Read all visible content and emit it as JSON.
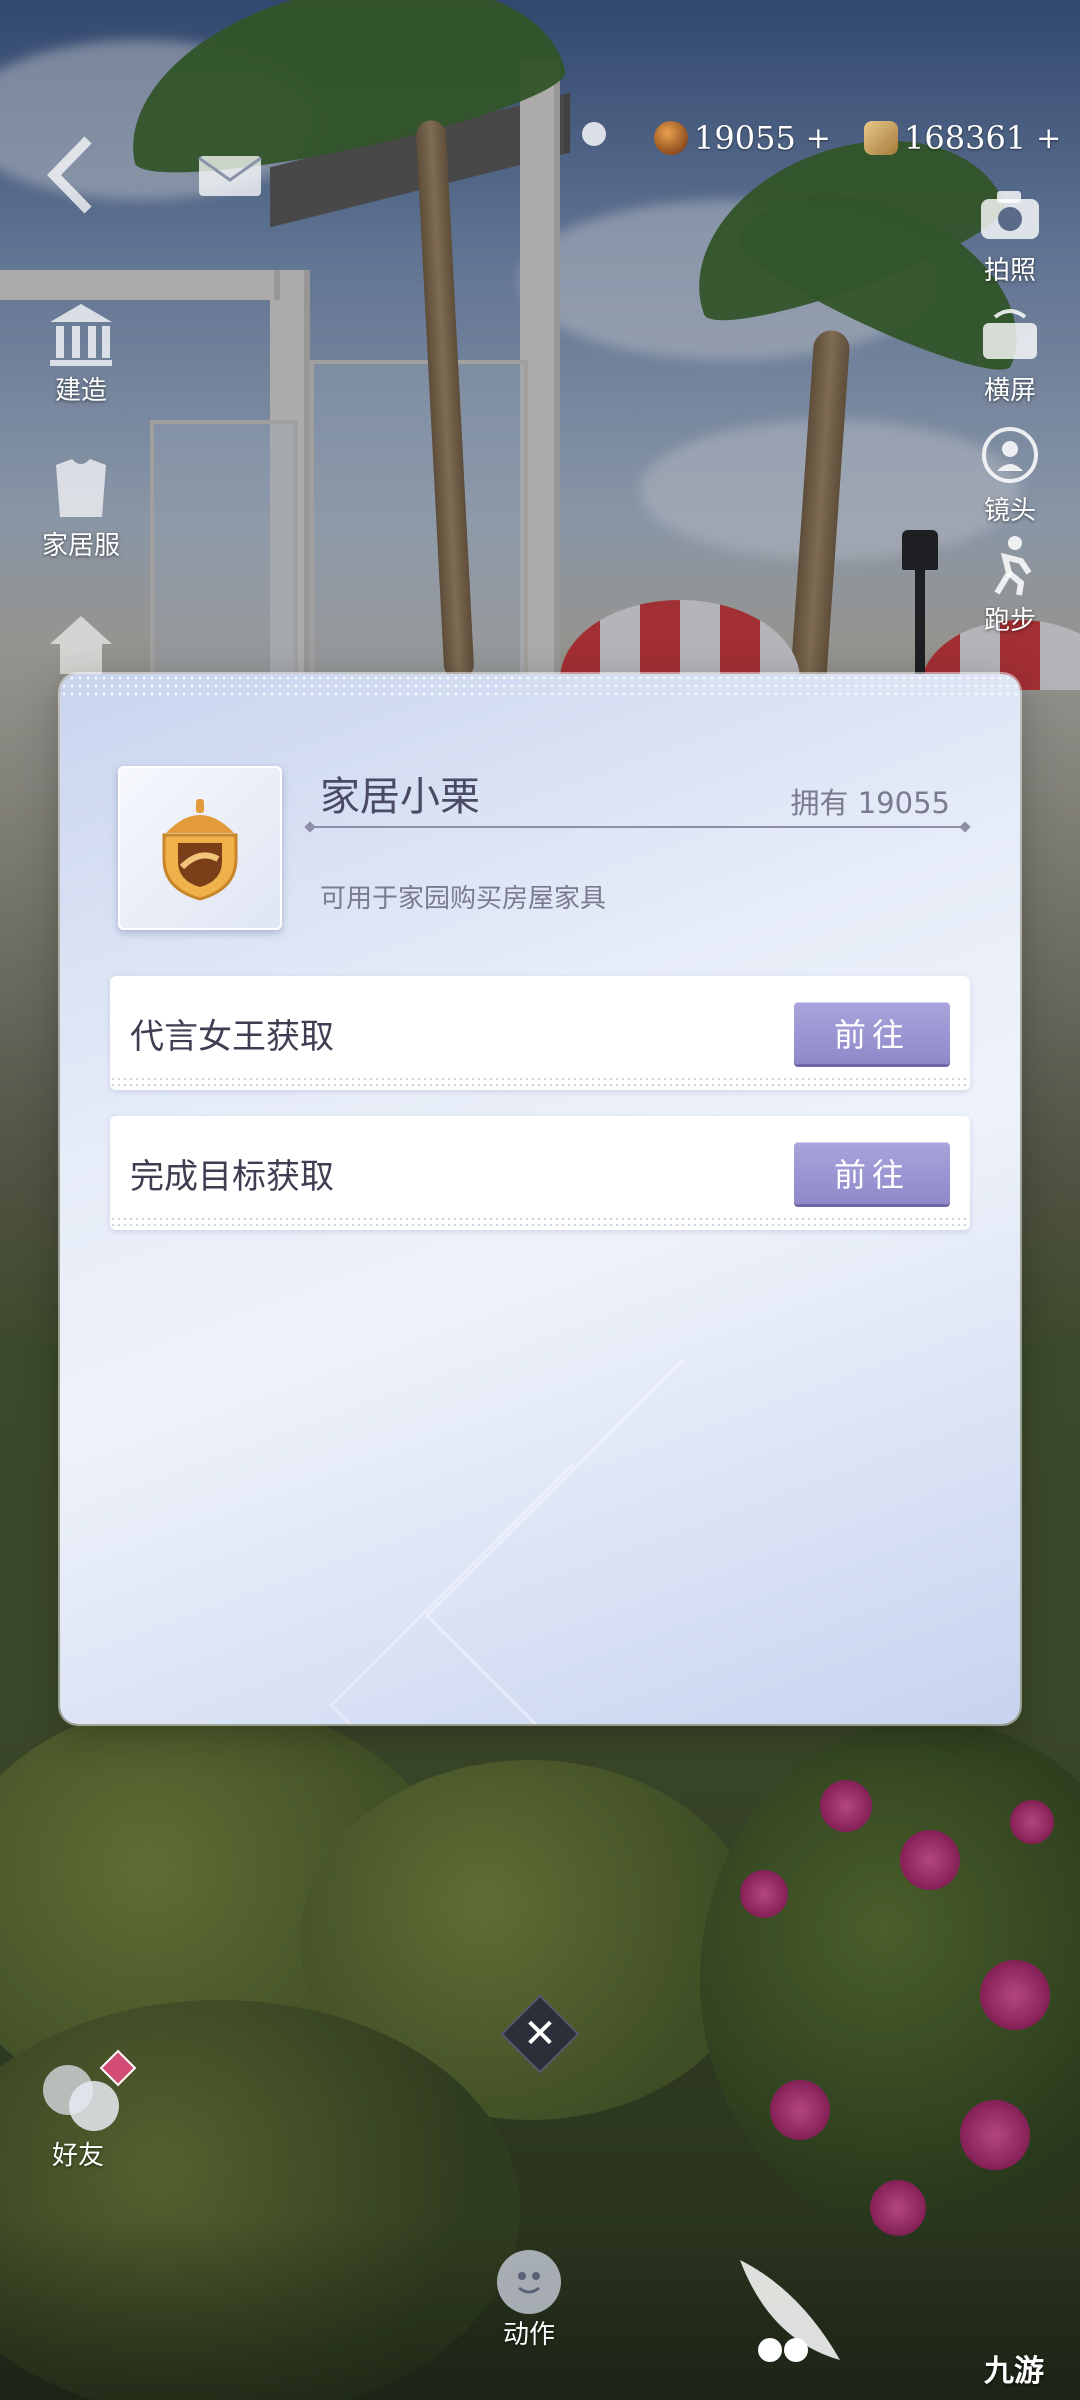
{
  "hud": {
    "currency": [
      {
        "icon": "acorn-coin-icon",
        "value": "19055",
        "plus": "+"
      },
      {
        "icon": "diamond-coin-icon",
        "value": "168361",
        "plus": "+"
      }
    ],
    "left_menu": [
      {
        "icon": "building-icon",
        "label": "建造"
      },
      {
        "icon": "clothes-icon",
        "label": "家居服"
      }
    ],
    "right_menu": [
      {
        "icon": "camera-icon",
        "label": "拍照"
      },
      {
        "icon": "rotate-screen-icon",
        "label": "横屏"
      },
      {
        "icon": "lens-icon",
        "label": "镜头"
      },
      {
        "icon": "run-icon",
        "label": "跑步"
      }
    ],
    "friends": {
      "icon": "friends-icon",
      "label": "好友"
    },
    "actions": {
      "icon": "action-face-icon",
      "label": "动作"
    }
  },
  "modal": {
    "item_name": "家居小栗",
    "owned": "拥有 19055",
    "description": "可用于家园购买房屋家具",
    "sources": [
      {
        "label": "代言女王获取",
        "button": "前往"
      },
      {
        "label": "完成目标获取",
        "button": "前往"
      }
    ]
  },
  "close": {
    "glyph": "✕"
  },
  "watermark": {
    "text": "九游"
  },
  "colors": {
    "button": "#9a95d3",
    "modal_bg": "#e6ecf8",
    "title": "#4a4a62"
  }
}
